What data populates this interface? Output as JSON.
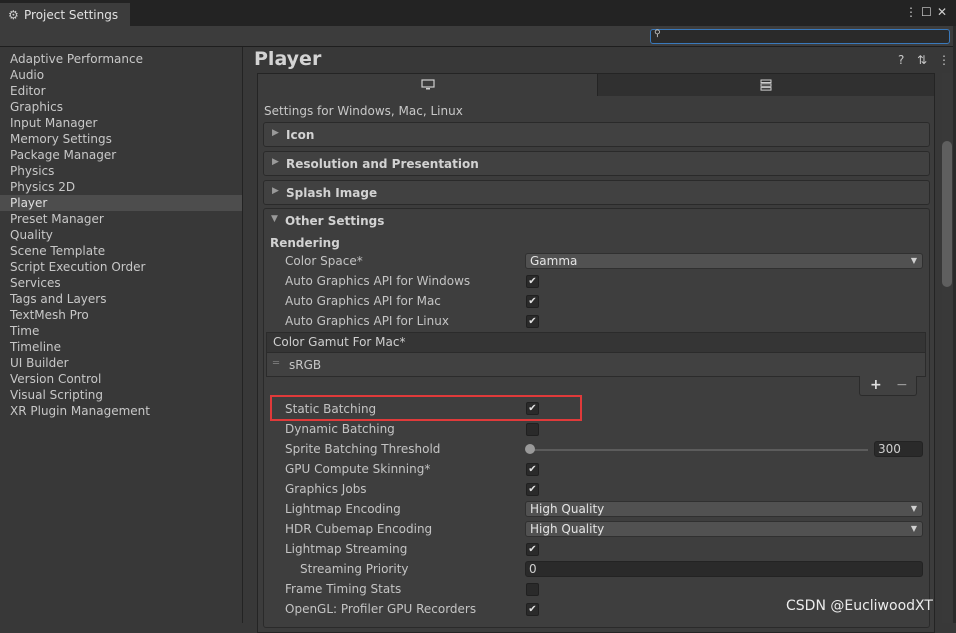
{
  "window": {
    "title": "Project Settings",
    "search_placeholder": "",
    "icons": [
      "gear-icon",
      "more-icon",
      "maximize-icon",
      "close-icon",
      "search-icon"
    ]
  },
  "sidebar": {
    "items": [
      "Adaptive Performance",
      "Audio",
      "Editor",
      "Graphics",
      "Input Manager",
      "Memory Settings",
      "Package Manager",
      "Physics",
      "Physics 2D",
      "Player",
      "Preset Manager",
      "Quality",
      "Scene Template",
      "Script Execution Order",
      "Services",
      "Tags and Layers",
      "TextMesh Pro",
      "Time",
      "Timeline",
      "UI Builder",
      "Version Control",
      "Visual Scripting",
      "XR Plugin Management"
    ],
    "selected": "Player"
  },
  "main": {
    "title": "Player",
    "platform_label": "Settings for Windows, Mac, Linux",
    "tabs": [
      {
        "icon": "monitor-icon"
      },
      {
        "icon": "server-icon"
      }
    ],
    "foldouts": {
      "icon": "Icon",
      "resolution": "Resolution and Presentation",
      "splash": "Splash Image",
      "other": "Other Settings"
    },
    "rendering": {
      "section": "Rendering",
      "color_space_label": "Color Space*",
      "color_space_value": "Gamma",
      "auto_win_label": "Auto Graphics API  for Windows",
      "auto_mac_label": "Auto Graphics API  for Mac",
      "auto_linux_label": "Auto Graphics API  for Linux",
      "gamut_header": "Color Gamut For Mac*",
      "gamut_item": "sRGB",
      "static_batching_label": "Static Batching",
      "dynamic_batching_label": "Dynamic Batching",
      "sprite_threshold_label": "Sprite Batching Threshold",
      "sprite_threshold_value": "300",
      "gpu_skinning_label": "GPU Compute Skinning*",
      "graphics_jobs_label": "Graphics Jobs",
      "lightmap_encoding_label": "Lightmap Encoding",
      "lightmap_encoding_value": "High Quality",
      "hdr_encoding_label": "HDR Cubemap Encoding",
      "hdr_encoding_value": "High Quality",
      "lightmap_streaming_label": "Lightmap Streaming",
      "streaming_priority_label": "Streaming Priority",
      "streaming_priority_value": "0",
      "frame_timing_label": "Frame Timing Stats",
      "opengl_profiler_label": "OpenGL: Profiler GPU Recorders"
    },
    "checks": {
      "auto_win": true,
      "auto_mac": true,
      "auto_linux": true,
      "static_batching": true,
      "dynamic_batching": false,
      "gpu_skinning": true,
      "graphics_jobs": true,
      "lightmap_streaming": true,
      "frame_timing": false,
      "opengl_profiler": true
    }
  },
  "watermark": "CSDN @EucliwoodXT"
}
